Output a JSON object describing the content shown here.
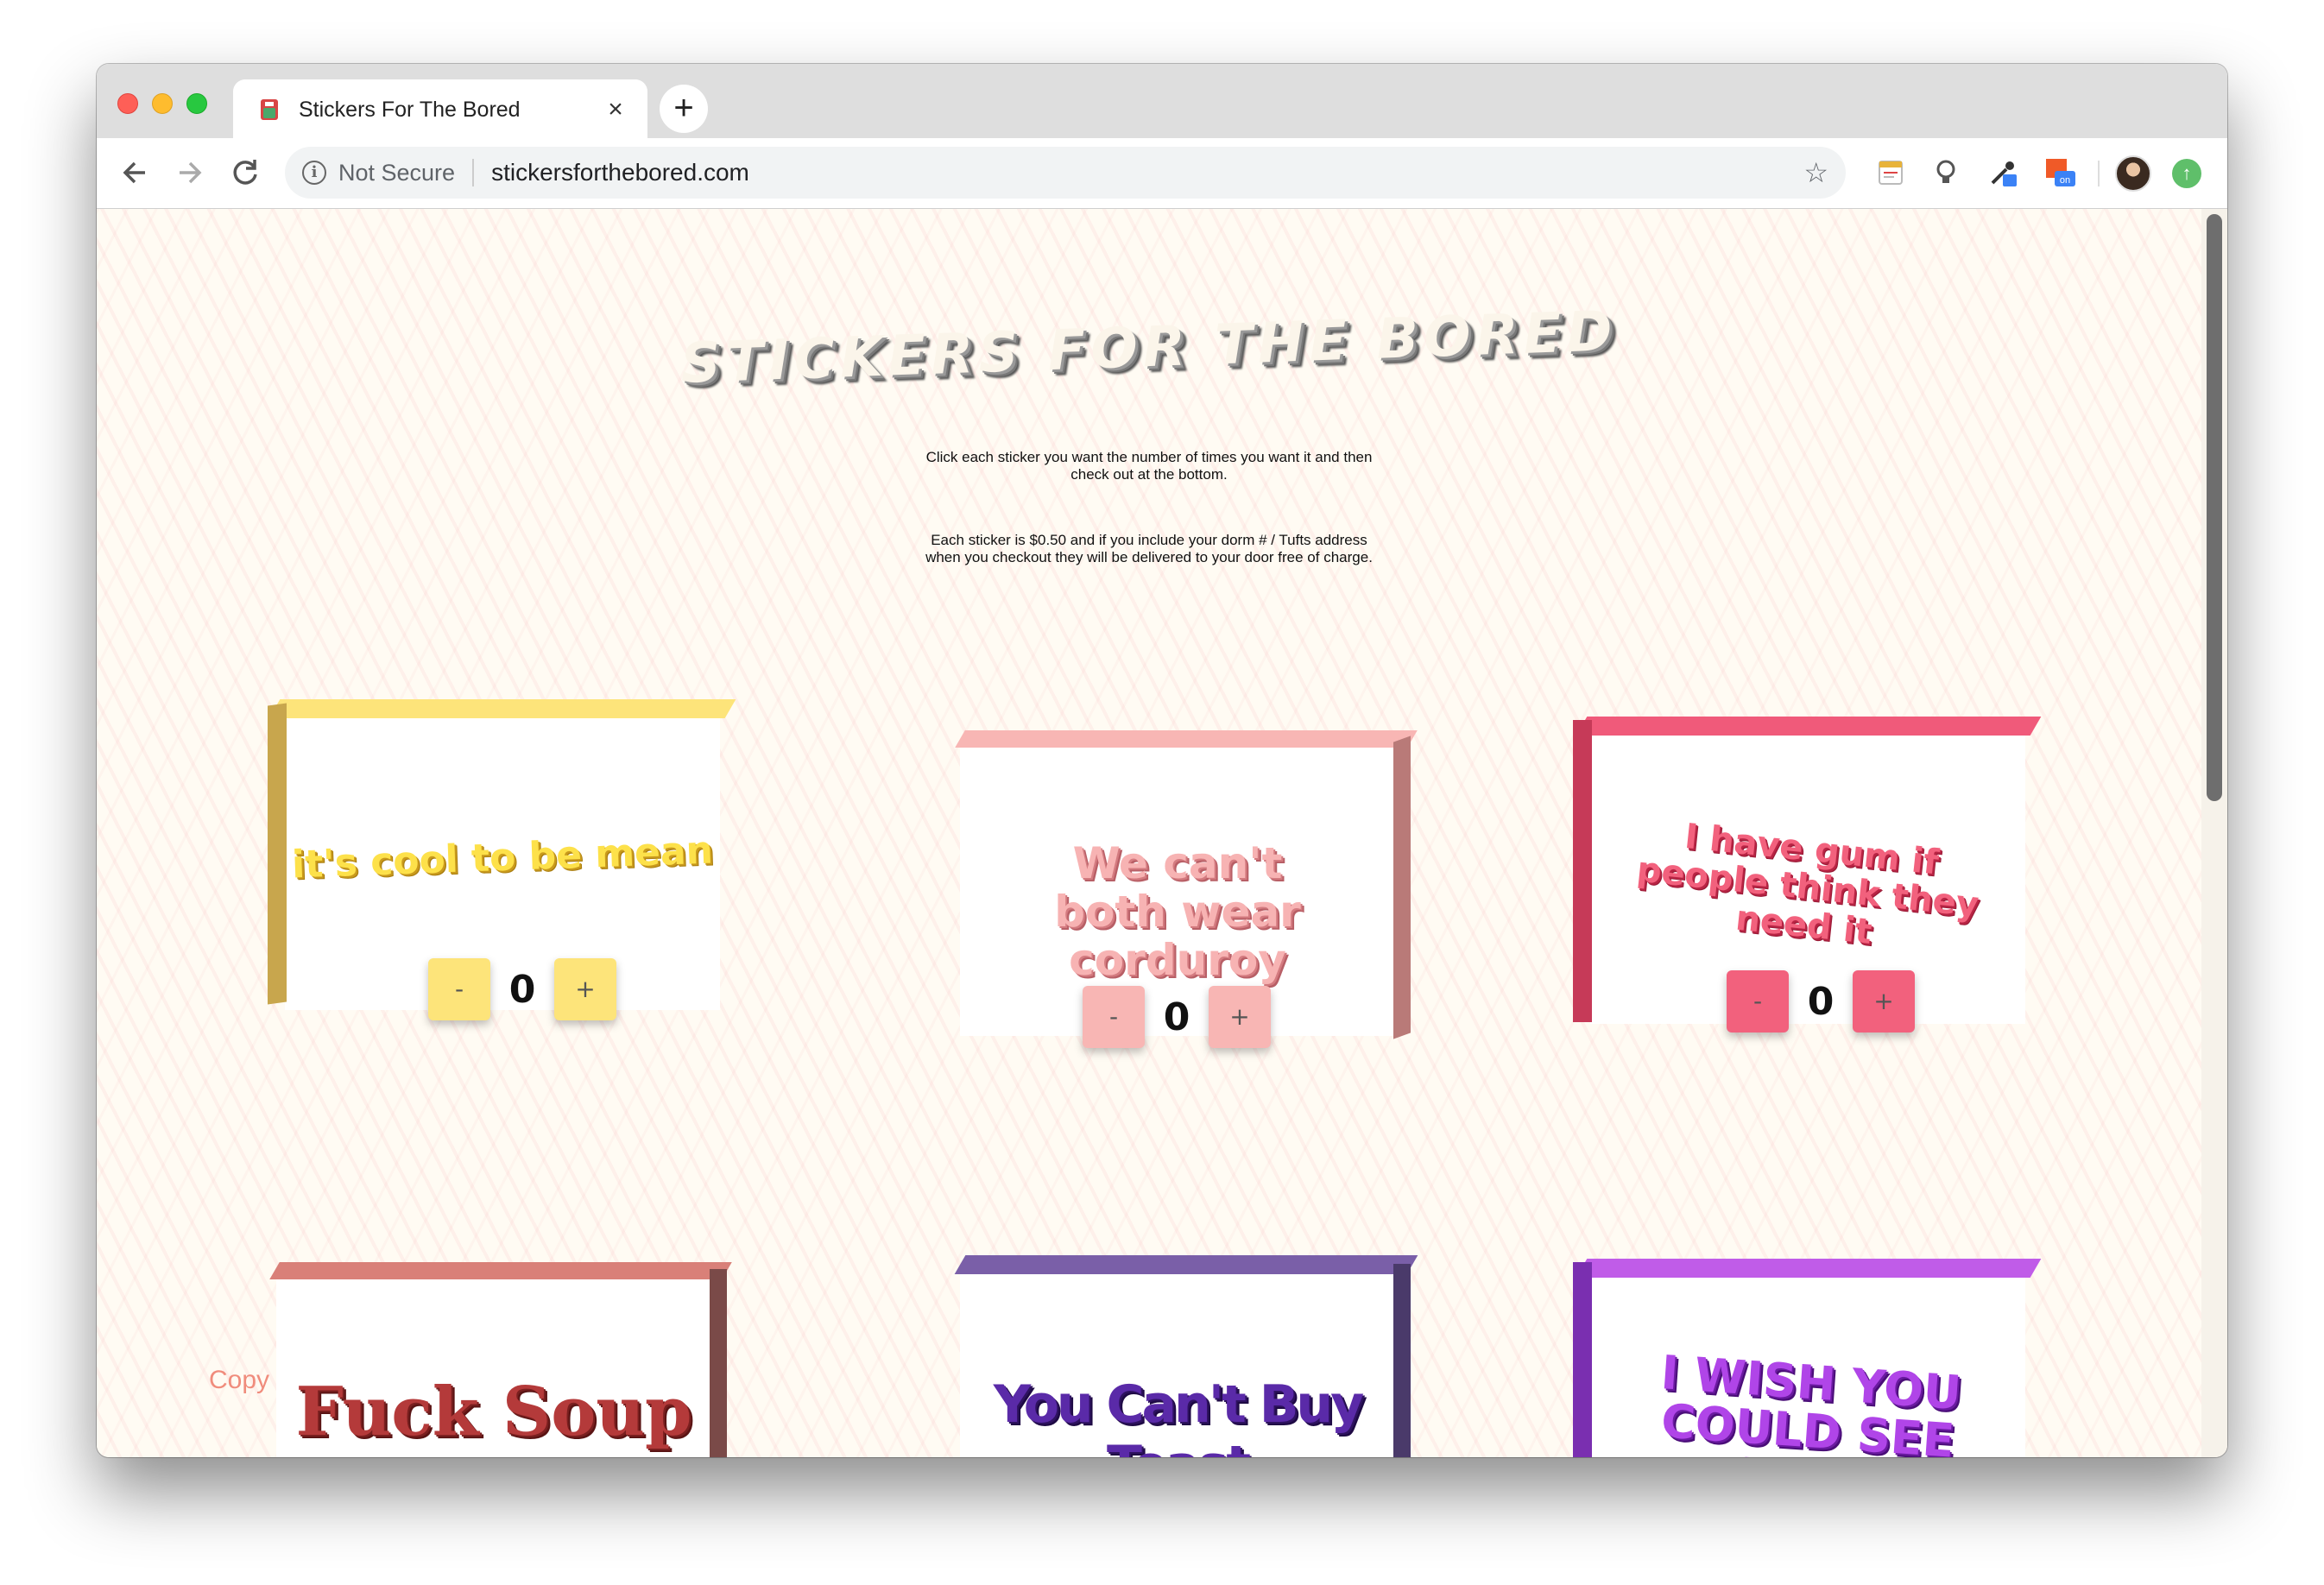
{
  "browser": {
    "tab_title": "Stickers For The Bored",
    "tab_close": "×",
    "new_tab": "+",
    "not_secure": "Not Secure",
    "url": "stickersforthebored.com"
  },
  "page": {
    "title": "STICKERS FOR THE BORED",
    "intro_1": "Click each sticker you want the number of times you want it and then check out at the bottom.",
    "intro_2": "Each sticker is $0.50 and if you include your dorm # / Tufts address when you checkout they will be delivered to your door free of charge.",
    "copyright_partial": "Copy"
  },
  "stickers": [
    {
      "text": "it's cool to be mean",
      "quantity": "0",
      "minus": "-",
      "plus": "+",
      "color": "#fde47a"
    },
    {
      "text": "We can't both wear corduroy",
      "quantity": "0",
      "minus": "-",
      "plus": "+",
      "color": "#f7b3b3"
    },
    {
      "text": "I have gum if people think they need it",
      "quantity": "0",
      "minus": "-",
      "plus": "+",
      "color": "#f2617d"
    },
    {
      "text": "Fuck Soup",
      "color": "#d98078"
    },
    {
      "text": "You Can't Buy Toast",
      "color": "#7a5fa8"
    },
    {
      "text": "I WISH YOU COULD SEE THIS",
      "color": "#c05ce8"
    }
  ]
}
